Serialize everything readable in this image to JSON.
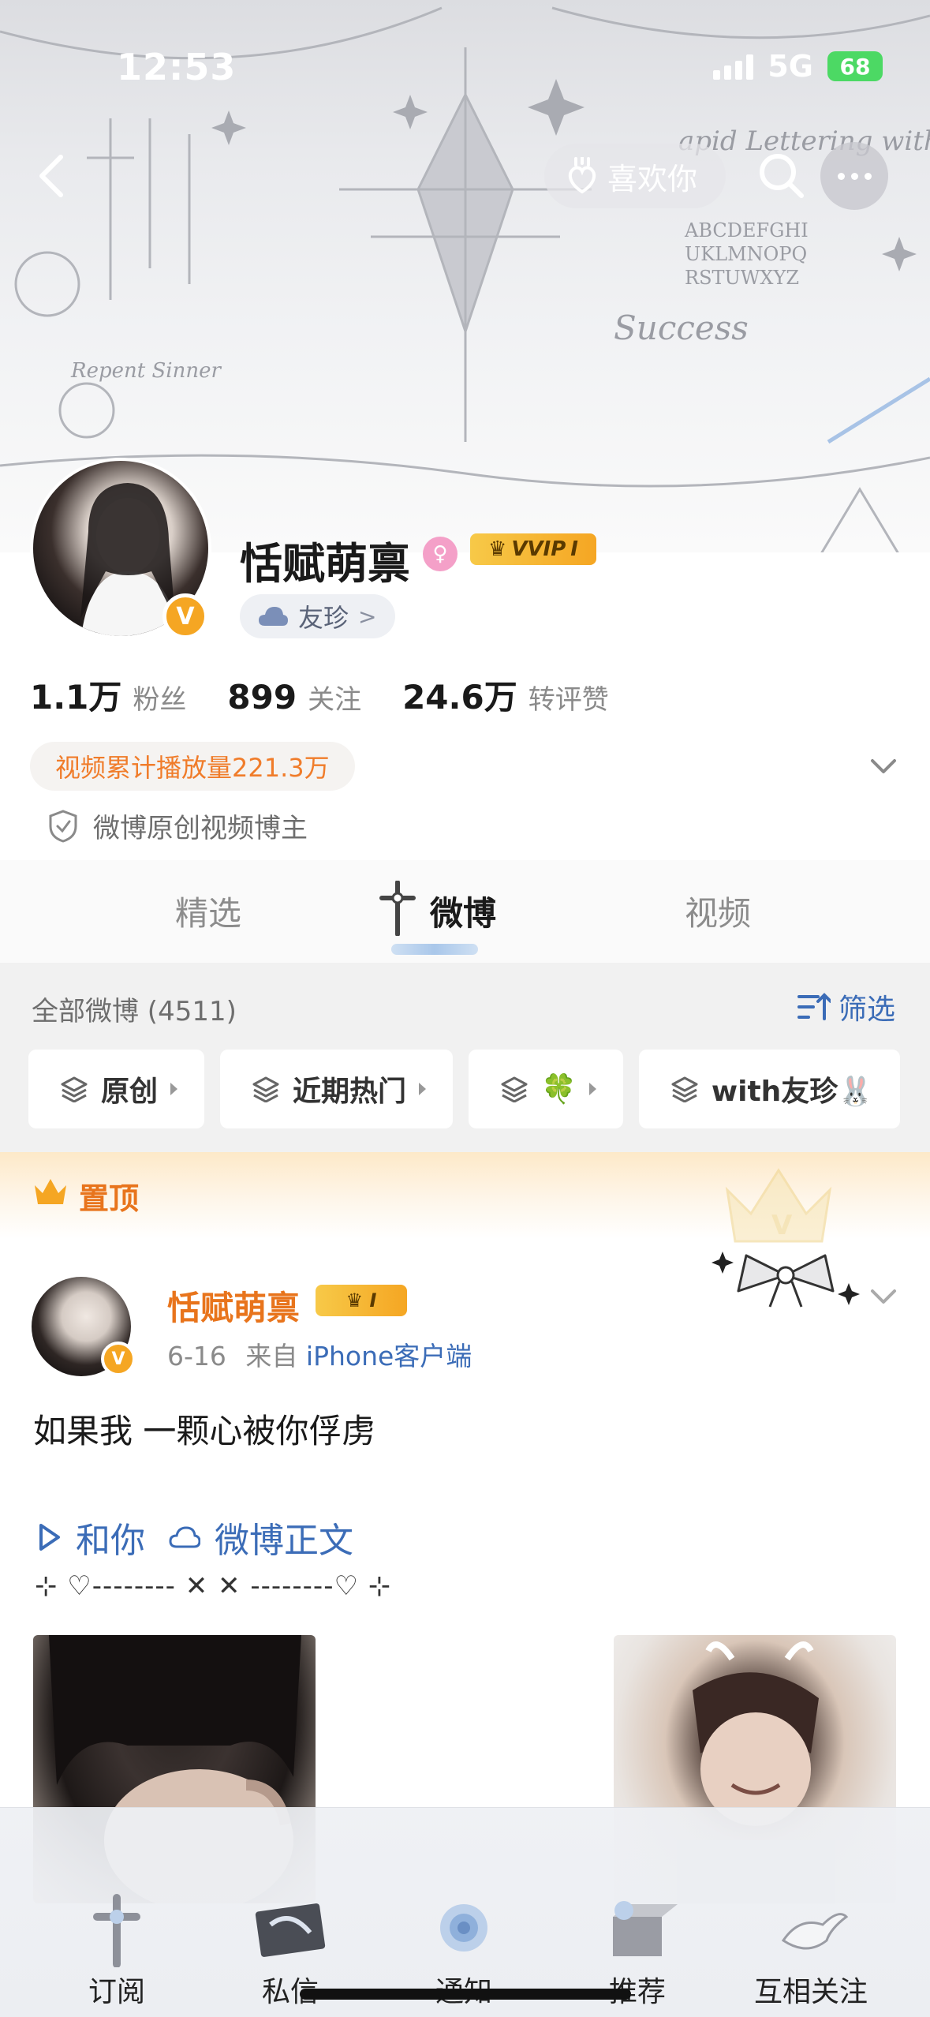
{
  "status_bar": {
    "time": "12:53",
    "network": "5G",
    "battery": "68"
  },
  "header": {
    "like_label": "喜欢你"
  },
  "banner_text": {
    "lettering": "apid Lettering with",
    "alphabet_1": "ABCDEFGHI",
    "alphabet_2": "UKLMNOPQ",
    "alphabet_3": "RSTUWXYZ",
    "success": "Success",
    "repent": "Repent Sinner"
  },
  "profile": {
    "name": "恬赋萌禀",
    "vip_label": "VVIP",
    "vip_level": "I",
    "friend_label": "友珍",
    "friend_chevron": ">",
    "stats": [
      {
        "num": "1.1万",
        "label": "粉丝"
      },
      {
        "num": "899",
        "label": "关注"
      },
      {
        "num": "24.6万",
        "label": "转评赞"
      }
    ],
    "video_views": "视频累计播放量221.3万",
    "creator_label": "微博原创视频博主"
  },
  "tabs": {
    "featured": "精选",
    "weibo": "微博",
    "video": "视频",
    "active": "weibo"
  },
  "filter": {
    "all_posts": "全部微博 (4511)",
    "filter_label": "筛选",
    "chips": [
      "原创",
      "近期热门",
      "🍀",
      "with友珍🐰"
    ]
  },
  "pinned": {
    "label": "置顶"
  },
  "post": {
    "author": "恬赋萌禀",
    "vip_level": "I",
    "date": "6-16",
    "source_prefix": "来自",
    "source": "iPhone客户端",
    "text": "如果我 一颗心被你俘虏",
    "link_1": "和你",
    "link_2": "微博正文",
    "deco_line": "⊹ ♡-------- ✕ ✕ --------♡ ⊹"
  },
  "bottom_nav": [
    {
      "label": "订阅",
      "icon": "cross-icon"
    },
    {
      "label": "私信",
      "icon": "message-card-icon"
    },
    {
      "label": "通知",
      "icon": "rose-icon"
    },
    {
      "label": "推荐",
      "icon": "box-icon"
    },
    {
      "label": "互相关注",
      "icon": "dove-icon"
    }
  ],
  "colors": {
    "accent_orange": "#e8741c",
    "link_blue": "#3b6cb7",
    "vip_gold": "#f5a623"
  }
}
